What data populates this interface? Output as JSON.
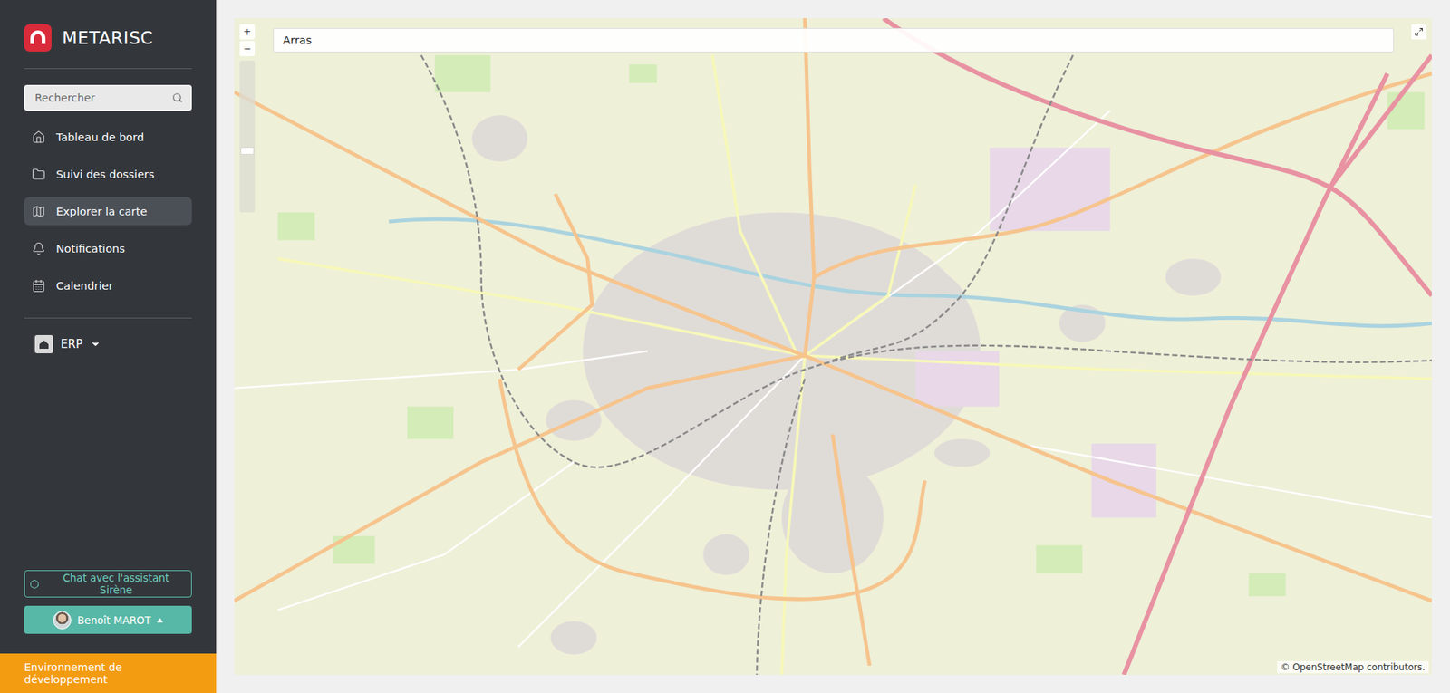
{
  "app": {
    "name": "METARISC"
  },
  "search": {
    "placeholder": "Rechercher"
  },
  "nav": [
    {
      "label": "Tableau de bord",
      "selected": false,
      "icon": "home"
    },
    {
      "label": "Suivi des dossiers",
      "selected": false,
      "icon": "folder"
    },
    {
      "label": "Explorer la carte",
      "selected": true,
      "icon": "map"
    },
    {
      "label": "Notifications",
      "selected": false,
      "icon": "bell"
    },
    {
      "label": "Calendrier",
      "selected": false,
      "icon": "calendar"
    }
  ],
  "module": {
    "label": "ERP"
  },
  "assistant": {
    "label": "Chat avec l'assistant Sirène"
  },
  "user": {
    "name": "Benoît MAROT"
  },
  "environment": {
    "label": "Environnement de développement"
  },
  "map": {
    "query": "Arras",
    "zoom_in": "+",
    "zoom_out": "−",
    "zoom_level": 0.4,
    "attribution": "© OpenStreetMap contributors."
  }
}
